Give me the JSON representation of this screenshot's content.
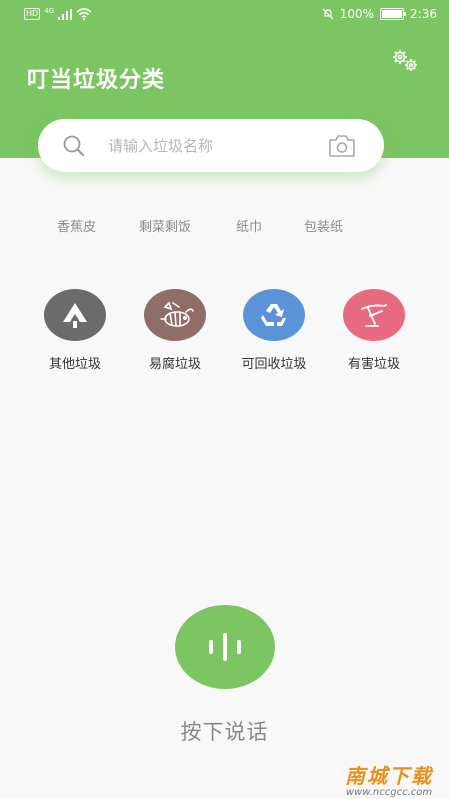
{
  "status_bar": {
    "left_badge": "HD",
    "network": "4G",
    "battery_percent_text": "100%",
    "battery_level": 1.0,
    "time": "2:36"
  },
  "header": {
    "title": "叮当垃圾分类",
    "bg_color": "#7cc563"
  },
  "search": {
    "placeholder": "请输入垃圾名称",
    "value": ""
  },
  "hot_tags": [
    "香蕉皮",
    "剩菜剩饭",
    "纸巾",
    "包装纸"
  ],
  "categories": [
    {
      "label": "其他垃圾",
      "color": "#6b6b6b",
      "icon": "other-waste-icon"
    },
    {
      "label": "易腐垃圾",
      "color": "#8e6e66",
      "icon": "fish-bone-icon"
    },
    {
      "label": "可回收垃圾",
      "color": "#5a93d8",
      "icon": "recycle-icon"
    },
    {
      "label": "有害垃圾",
      "color": "#e86a80",
      "icon": "hazardous-icon"
    }
  ],
  "voice": {
    "label": "按下说话",
    "icon": "voice-wave-icon"
  },
  "watermark": {
    "title": "南城下载",
    "url": "www.nccgcc.com"
  }
}
